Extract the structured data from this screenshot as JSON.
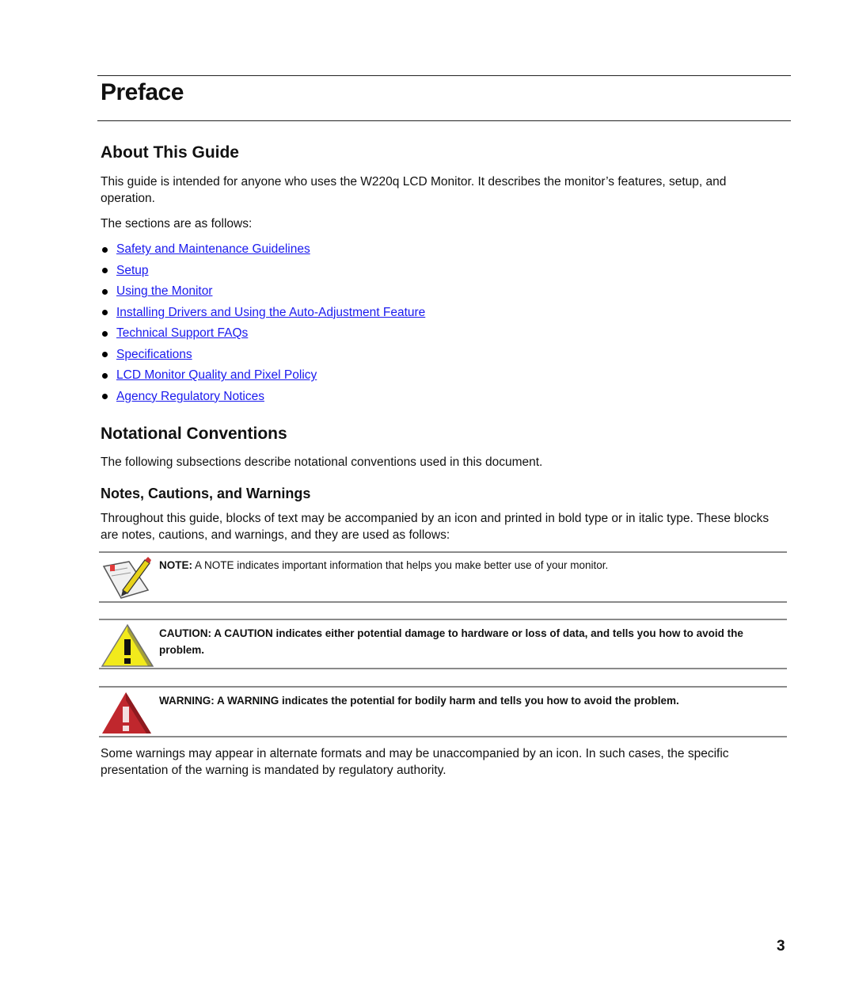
{
  "page": {
    "title": "Preface",
    "page_number": "3"
  },
  "about": {
    "heading": "About This Guide",
    "intro": "This guide is intended for anyone who uses the W220q LCD Monitor. It describes the monitor’s features, setup, and operation.",
    "sections_intro": "The sections are as follows:",
    "links": [
      "Safety and Maintenance Guidelines",
      "Setup",
      "Using the Monitor",
      "Installing Drivers and Using the Auto-Adjustment Feature",
      "Technical Support FAQs",
      "Specifications",
      "LCD Monitor Quality and Pixel Policy",
      "Agency Regulatory Notices"
    ],
    "link_color": "#1a1aee"
  },
  "conventions": {
    "heading": "Notational Conventions",
    "intro": "The following subsections describe notational conventions used in this document.",
    "subheading": "Notes, Cautions, and Warnings",
    "sub_intro": "Throughout this guide, blocks of text may be accompanied by an icon and printed in bold type or in italic type. These blocks are notes, cautions, and warnings, and they are used as follows:",
    "note": {
      "icon": "note-pencil-icon",
      "label": "NOTE:",
      "text": " A NOTE indicates important information that helps you make better use of your monitor."
    },
    "caution": {
      "icon": "caution-triangle-icon",
      "color": "#f2ea1c",
      "text": "CAUTION: A CAUTION indicates either potential damage to hardware or loss of data, and tells you how to avoid the problem."
    },
    "warning": {
      "icon": "warning-triangle-icon",
      "color": "#c0272d",
      "text": "WARNING: A WARNING indicates the potential for bodily harm and tells you how to avoid the problem."
    },
    "closing": "Some warnings may appear in alternate formats and may be unaccompanied by an icon. In such cases, the specific presentation of the warning is mandated by regulatory authority."
  }
}
